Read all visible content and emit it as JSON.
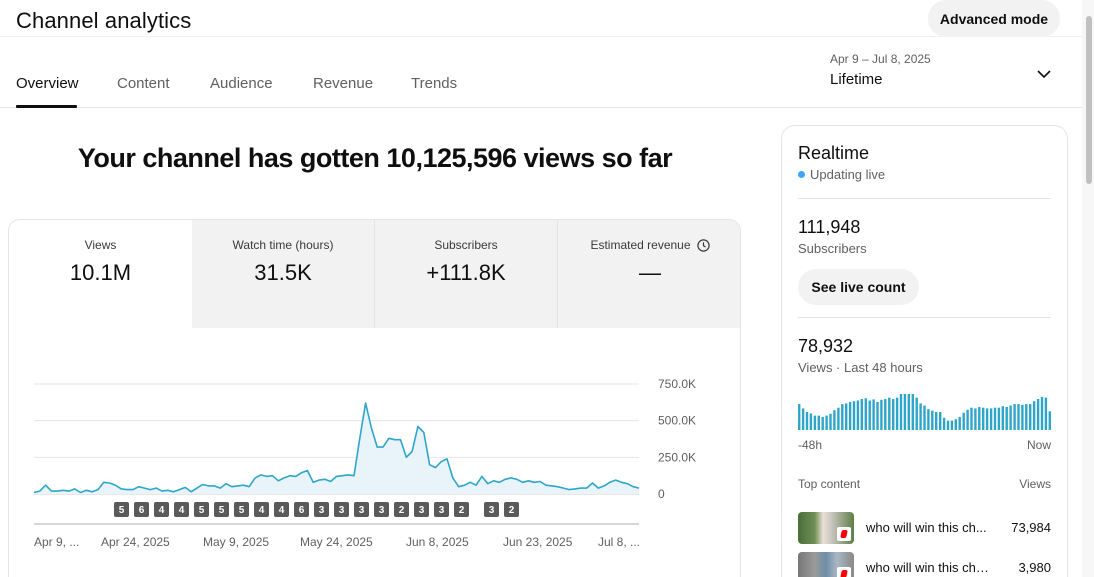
{
  "header": {
    "title": "Channel analytics",
    "advanced_mode_label": "Advanced mode"
  },
  "tabs": [
    {
      "label": "Overview",
      "active": true
    },
    {
      "label": "Content"
    },
    {
      "label": "Audience"
    },
    {
      "label": "Revenue"
    },
    {
      "label": "Trends"
    }
  ],
  "date_picker": {
    "range": "Apr 9 – Jul 8, 2025",
    "label": "Lifetime",
    "icon": "chevron-down-icon"
  },
  "headline": "Your channel has gotten 10,125,596 views so far",
  "metrics": [
    {
      "label": "Views",
      "value": "10.1M",
      "active": true
    },
    {
      "label": "Watch time (hours)",
      "value": "31.5K"
    },
    {
      "label": "Subscribers",
      "value": "+111.8K"
    },
    {
      "label": "Estimated revenue",
      "value": "—",
      "icon": "clock-icon"
    }
  ],
  "chart_data": {
    "type": "area",
    "y_tick_labels": [
      "750.0K",
      "500.0K",
      "250.0K",
      "0"
    ],
    "x_tick_labels": [
      "Apr 9, ...",
      "Apr 24, 2025",
      "May 9, 2025",
      "May 24, 2025",
      "Jun 8, 2025",
      "Jun 23, 2025",
      "Jul 8, ..."
    ],
    "ylim": [
      0,
      750000
    ],
    "grid": true,
    "series": [
      {
        "values": [
          10000,
          20000,
          60000,
          20000,
          20000,
          25000,
          20000,
          35000,
          10000,
          25000,
          15000,
          30000,
          80000,
          75000,
          60000,
          35000,
          30000,
          30000,
          50000,
          40000,
          30000,
          40000,
          20000,
          25000,
          15000,
          30000,
          45000,
          15000,
          40000,
          65000,
          55000,
          55000,
          40000,
          70000,
          50000,
          55000,
          60000,
          50000,
          110000,
          130000,
          120000,
          125000,
          90000,
          110000,
          125000,
          120000,
          145000,
          160000,
          80000,
          95000,
          100000,
          85000,
          120000,
          125000,
          130000,
          125000,
          380000,
          620000,
          450000,
          320000,
          320000,
          380000,
          370000,
          370000,
          250000,
          290000,
          460000,
          420000,
          200000,
          180000,
          220000,
          240000,
          110000,
          50000,
          60000,
          80000,
          60000,
          120000,
          70000,
          90000,
          80000,
          100000,
          110000,
          100000,
          80000,
          90000,
          80000,
          85000,
          60000,
          55000,
          50000,
          40000,
          30000,
          35000,
          40000,
          40000,
          75000,
          40000,
          55000,
          80000,
          95000,
          80000,
          70000,
          50000,
          40000
        ]
      }
    ],
    "badges": [
      "5",
      "6",
      "4",
      "4",
      "5",
      "5",
      "5",
      "4",
      "4",
      "6",
      "3",
      "3",
      "3",
      "3",
      "2",
      "3",
      "3",
      "2",
      "3",
      "2"
    ]
  },
  "realtime": {
    "title": "Realtime",
    "status": "Updating live",
    "subscribers_value": "111,948",
    "subscribers_label": "Subscribers",
    "live_count_button": "See live count",
    "views_value": "78,932",
    "views_label": "Views · Last 48 hours",
    "bars_relative": [
      0.72,
      0.6,
      0.5,
      0.46,
      0.4,
      0.4,
      0.36,
      0.4,
      0.45,
      0.55,
      0.62,
      0.72,
      0.74,
      0.78,
      0.8,
      0.82,
      0.86,
      0.88,
      0.82,
      0.85,
      0.78,
      0.84,
      0.86,
      0.9,
      0.86,
      0.9,
      1.0,
      1.0,
      1.0,
      1.0,
      0.9,
      0.74,
      0.68,
      0.58,
      0.54,
      0.5,
      0.5,
      0.34,
      0.26,
      0.26,
      0.3,
      0.36,
      0.48,
      0.56,
      0.62,
      0.6,
      0.64,
      0.62,
      0.6,
      0.6,
      0.62,
      0.62,
      0.66,
      0.64,
      0.68,
      0.72,
      0.72,
      0.7,
      0.72,
      0.72,
      0.8,
      0.86,
      0.92,
      0.9,
      0.52
    ],
    "axis_start": "-48h",
    "axis_end": "Now",
    "top_content_label": "Top content",
    "views_column_label": "Views",
    "top_content": [
      {
        "title": "who will win this ch...",
        "views": "73,984"
      },
      {
        "title": "who will win this cha...",
        "views": "3,980"
      }
    ]
  }
}
